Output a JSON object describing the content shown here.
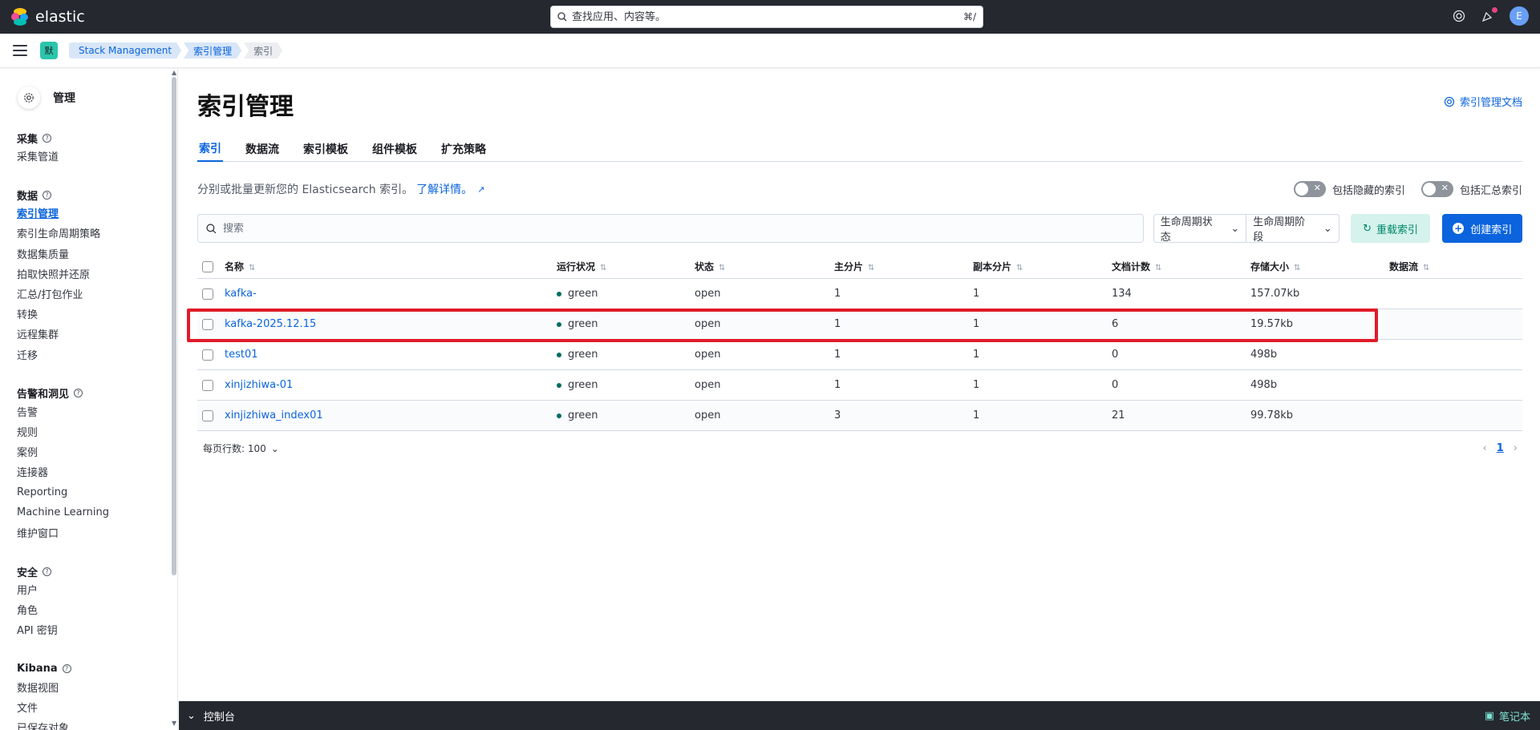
{
  "header": {
    "brand": "elastic",
    "search_placeholder": "查找应用、内容等。",
    "search_shortcut": "⌘/",
    "avatar_initial": "E"
  },
  "subheader": {
    "space_badge": "默",
    "breadcrumbs": [
      "Stack Management",
      "索引管理",
      "索引"
    ]
  },
  "sidebar": {
    "title": "管理",
    "groups": [
      {
        "title": "采集",
        "items": [
          "采集管道"
        ]
      },
      {
        "title": "数据",
        "items": [
          "索引管理",
          "索引生命周期策略",
          "数据集质量",
          "拍取快照并还原",
          "汇总/打包作业",
          "转换",
          "远程集群",
          "迁移"
        ]
      },
      {
        "title": "告警和洞见",
        "items": [
          "告警",
          "规则",
          "案例",
          "连接器",
          "Reporting",
          "Machine Learning",
          "维护窗口"
        ]
      },
      {
        "title": "安全",
        "items": [
          "用户",
          "角色",
          "API 密钥"
        ]
      },
      {
        "title": "Kibana",
        "items": [
          "数据视图",
          "文件",
          "已保存对象"
        ]
      }
    ],
    "active_item": "索引管理"
  },
  "main": {
    "title": "索引管理",
    "doc_link": "索引管理文档",
    "tabs": [
      "索引",
      "数据流",
      "索引模板",
      "组件模板",
      "扩充策略"
    ],
    "active_tab": "索引",
    "description": "分别或批量更新您的 Elasticsearch 索引。",
    "learn_more": "了解详情。",
    "toggle_hidden": "包括隐藏的索引",
    "toggle_rollup": "包括汇总索引",
    "search_placeholder": "搜索",
    "filter_lifecycle_status": "生命周期状态",
    "filter_lifecycle_phase": "生命周期阶段",
    "reload_button": "重载索引",
    "create_button": "创建索引",
    "columns": [
      "名称",
      "运行状况",
      "状态",
      "主分片",
      "副本分片",
      "文档计数",
      "存储大小",
      "数据流"
    ],
    "rows": [
      {
        "name": "kafka-",
        "health": "green",
        "status": "open",
        "primary": "1",
        "replica": "1",
        "docs": "134",
        "size": "157.07kb",
        "data_stream": ""
      },
      {
        "name": "kafka-2025.12.15",
        "health": "green",
        "status": "open",
        "primary": "1",
        "replica": "1",
        "docs": "6",
        "size": "19.57kb",
        "data_stream": ""
      },
      {
        "name": "test01",
        "health": "green",
        "status": "open",
        "primary": "1",
        "replica": "1",
        "docs": "0",
        "size": "498b",
        "data_stream": ""
      },
      {
        "name": "xinjizhiwa-01",
        "health": "green",
        "status": "open",
        "primary": "1",
        "replica": "1",
        "docs": "0",
        "size": "498b",
        "data_stream": ""
      },
      {
        "name": "xinjizhiwa_index01",
        "health": "green",
        "status": "open",
        "primary": "3",
        "replica": "1",
        "docs": "21",
        "size": "99.78kb",
        "data_stream": ""
      }
    ],
    "rows_per_page_label": "每页行数: 100",
    "current_page": "1"
  },
  "console": {
    "label": "控制台",
    "notebook": "笔记本"
  },
  "colors": {
    "accent": "#0b64dd",
    "header_bg": "#25282f",
    "health_green": "#006d62",
    "highlight": "#e01b2a"
  }
}
